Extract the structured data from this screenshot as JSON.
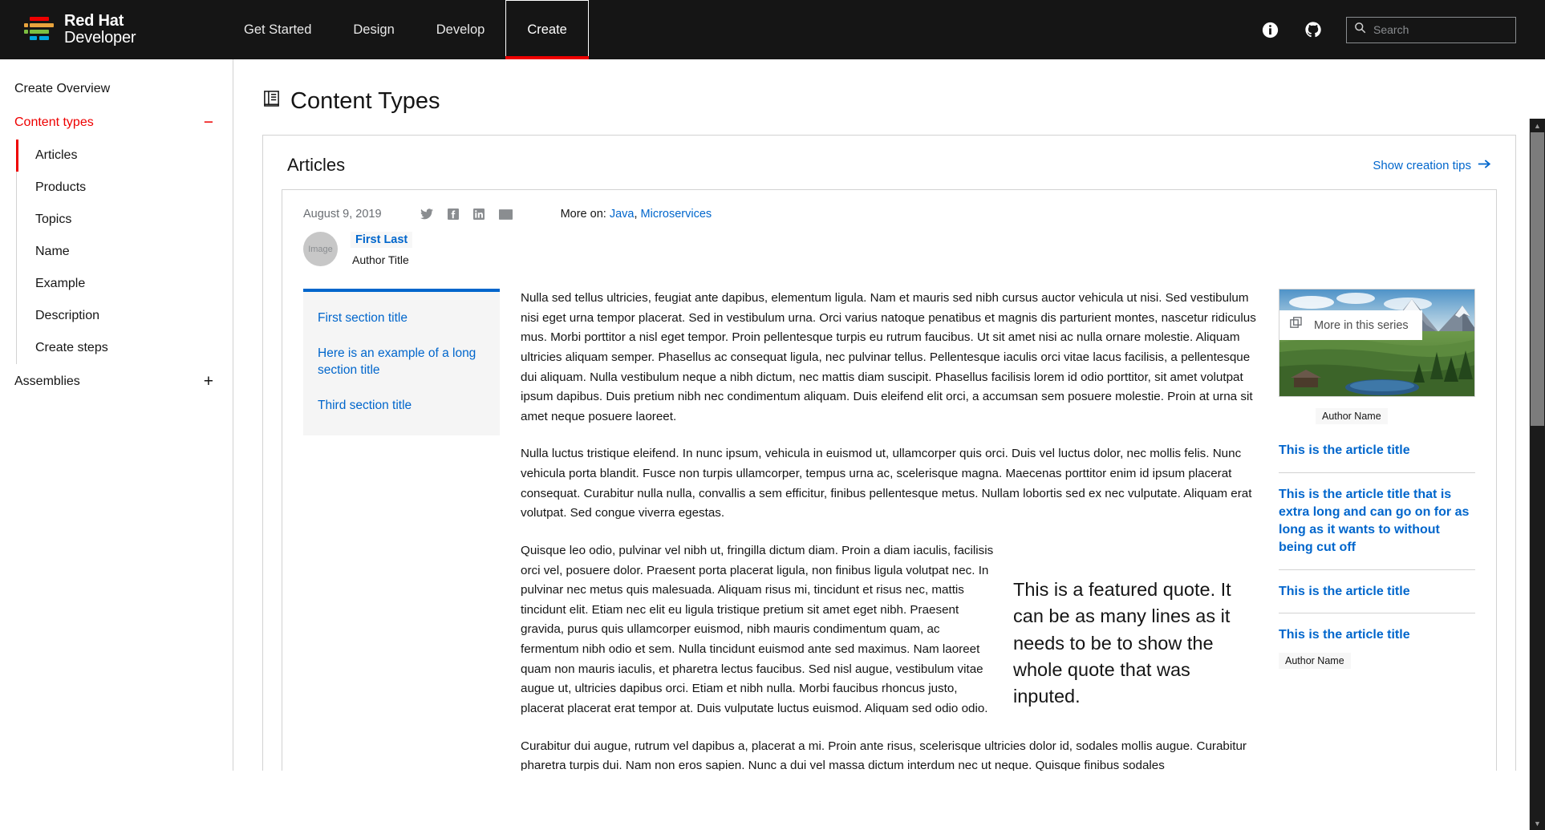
{
  "header": {
    "brand_line1": "Red Hat",
    "brand_line2": "Developer",
    "nav": [
      {
        "label": "Get Started",
        "active": false
      },
      {
        "label": "Design",
        "active": false
      },
      {
        "label": "Develop",
        "active": false
      },
      {
        "label": "Create",
        "active": true
      }
    ],
    "info_icon": "info-circle-icon",
    "github_icon": "github-icon",
    "search": {
      "placeholder": "Search",
      "value": "",
      "icon": "search-icon"
    },
    "accent_red": "#ee0000",
    "background": "#151515"
  },
  "sidebar": {
    "overview_label": "Create Overview",
    "groups": [
      {
        "label": "Content types",
        "expanded": true,
        "toggle": "−",
        "items": [
          {
            "label": "Articles",
            "active": true
          },
          {
            "label": "Products",
            "active": false
          },
          {
            "label": "Topics",
            "active": false
          },
          {
            "label": "Name",
            "active": false
          },
          {
            "label": "Example",
            "active": false
          },
          {
            "label": "Description",
            "active": false
          },
          {
            "label": "Create steps",
            "active": false
          }
        ]
      },
      {
        "label": "Assemblies",
        "expanded": false,
        "toggle": "+",
        "items": []
      }
    ]
  },
  "main": {
    "page_title": "Content Types",
    "page_title_icon": "book-icon",
    "panel_title": "Articles",
    "tips_link": "Show creation tips",
    "tips_arrow": "→"
  },
  "article": {
    "date": "August 9, 2019",
    "social": [
      "twitter-icon",
      "facebook-icon",
      "linkedin-icon",
      "email-icon"
    ],
    "more_on_label": "More on:",
    "more_on_tags": [
      "Java",
      "Microservices"
    ],
    "avatar_placeholder": "Image",
    "author_name": "First Last",
    "author_title": "Author Title",
    "toc": [
      "First section title",
      "Here is an example of a long section title",
      "Third section title"
    ],
    "paragraphs": [
      "Nulla sed tellus ultricies, feugiat ante dapibus, elementum ligula. Nam et mauris sed nibh cursus auctor vehicula ut nisi. Sed vestibulum nisi eget urna tempor placerat. Sed in vestibulum urna. Orci varius natoque penatibus et magnis dis parturient montes, nascetur ridiculus mus. Morbi porttitor a nisl eget tempor. Proin pellentesque turpis eu rutrum faucibus. Ut sit amet nisi ac nulla ornare molestie. Aliquam ultricies aliquam semper. Phasellus ac consequat ligula, nec pulvinar tellus. Pellentesque iaculis orci vitae lacus facilisis, a pellentesque dui aliquam. Nulla vestibulum neque a nibh dictum, nec mattis diam suscipit. Phasellus facilisis lorem id odio porttitor, sit amet volutpat ipsum dapibus. Duis pretium nibh nec condimentum aliquam. Duis eleifend elit orci, a accumsan sem posuere molestie. Proin at urna sit amet neque posuere laoreet.",
      "Nulla luctus tristique eleifend. In nunc ipsum, vehicula in euismod ut, ullamcorper quis orci. Duis vel luctus dolor, nec mollis felis. Nunc vehicula porta blandit. Fusce non turpis ullamcorper, tempus urna ac, scelerisque magna. Maecenas porttitor enim id ipsum placerat consequat. Curabitur nulla nulla, convallis a sem efficitur, finibus pellentesque metus. Nullam lobortis sed ex nec vulputate. Aliquam erat volutpat. Sed congue viverra egestas.",
      "Quisque leo odio, pulvinar vel nibh ut, fringilla dictum diam. Proin a diam iaculis, facilisis orci vel, posuere dolor. Praesent porta placerat ligula, non finibus ligula volutpat nec. In pulvinar nec metus quis malesuada. Aliquam risus mi, tincidunt et risus nec, mattis tincidunt elit. Etiam nec elit eu ligula tristique pretium sit amet eget nibh. Praesent gravida, purus quis ullamcorper euismod, nibh mauris condimentum quam, ac fermentum nibh odio et sem. Nulla tincidunt euismod ante sed maximus. Nam laoreet quam non mauris iaculis, et pharetra lectus faucibus. Sed nisl augue, vestibulum vitae augue ut, ultricies dapibus orci. Etiam et nibh nulla. Morbi faucibus rhoncus justo, placerat placerat erat tempor at. Duis vulputate luctus euismod. Aliquam sed odio odio.",
      "Curabitur dui augue, rutrum vel dapibus a, placerat a mi. Proin ante risus, scelerisque ultricies dolor id, sodales mollis augue. Curabitur pharetra turpis dui. Nam non eros sapien. Nunc a dui vel massa dictum interdum nec ut neque. Quisque finibus sodales"
    ],
    "featured_quote": "This is a featured quote. It can be as many lines as it needs to be to show the whole quote that was inputed."
  },
  "series": {
    "badge_label": "More in this series",
    "badge_icon": "copy-icon",
    "image_alt": "mountain-landscape",
    "top_author": "Author Name",
    "items": [
      {
        "title": "This is the article title",
        "author": ""
      },
      {
        "title": "This is the article title that is extra long and can go on for as long as it wants to without being cut off",
        "author": ""
      },
      {
        "title": "This is the article title",
        "author": ""
      },
      {
        "title": "This is the article title",
        "author": "Author Name"
      }
    ]
  },
  "scrollbar": {
    "up_arrow": "▲",
    "down_arrow": "▼"
  }
}
